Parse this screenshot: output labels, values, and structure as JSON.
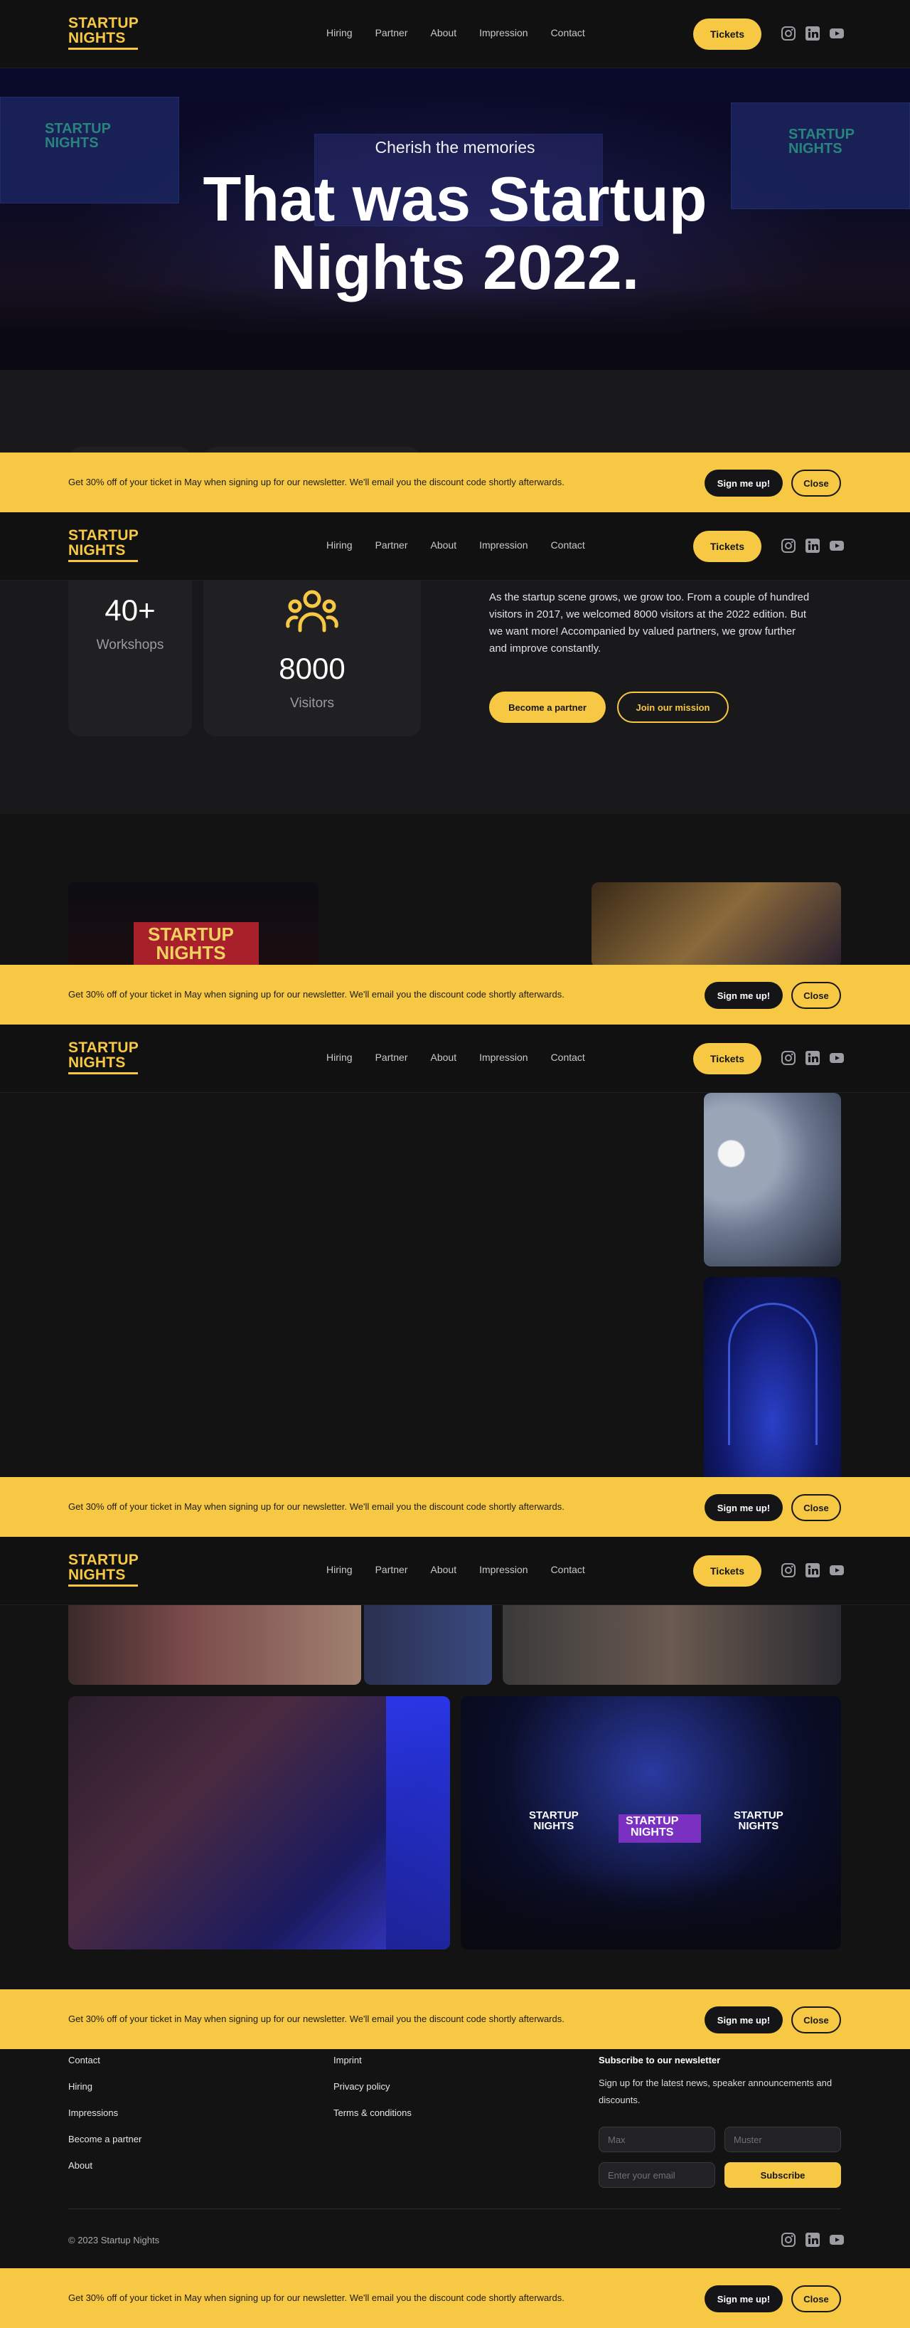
{
  "logo": {
    "line1": "STARTUP",
    "line2": "NIGHTS"
  },
  "nav": {
    "items": [
      {
        "label": "Hiring"
      },
      {
        "label": "Partner"
      },
      {
        "label": "About"
      },
      {
        "label": "Impression"
      },
      {
        "label": "Contact"
      }
    ],
    "tickets_label": "Tickets",
    "social_icons": [
      "instagram-icon",
      "linkedin-icon",
      "youtube-icon"
    ]
  },
  "hero": {
    "subtitle": "Cherish the memories",
    "title_line1": "That was Startup",
    "title_line2": "Nights 2022.",
    "screen_text": "STARTUP NIGHTS"
  },
  "stats": [
    {
      "value": "40+",
      "label": "Workshops"
    },
    {
      "value": "8000",
      "label": "Visitors",
      "icon": "people-group-icon"
    }
  ],
  "about": {
    "text": "As the startup scene grows, we grow too. From a couple of hundred visitors in 2017, we welcomed 8000 visitors at the 2022 edition. But we want more! Accompanied by valued partners, we grow further and improve constantly.",
    "partner_button": "Become a partner",
    "mission_button": "Join our mission"
  },
  "gallery": {
    "stage_logo_line1": "STARTUP",
    "stage_logo_line2": "NIGHTS"
  },
  "newsletter_bar": {
    "text": "Get 30% off of your ticket in May when signing up for our newsletter. We'll email you the discount code shortly afterwards.",
    "signup_label": "Sign me up!",
    "close_label": "Close"
  },
  "footer": {
    "col1": [
      "Contact",
      "Hiring",
      "Impressions",
      "Become a partner",
      "About"
    ],
    "col2": [
      "Imprint",
      "Privacy policy",
      "Terms & conditions"
    ],
    "subscribe_heading": "Subscribe to our newsletter",
    "subscribe_desc": "Sign up for the latest news, speaker announcements and discounts.",
    "first_name_placeholder": "Max",
    "last_name_placeholder": "Muster",
    "email_placeholder": "Enter your email",
    "subscribe_button": "Subscribe",
    "copyright": "© 2023 Startup Nights"
  },
  "colors": {
    "accent": "#f7c844",
    "background": "#131314",
    "card": "#202022"
  }
}
